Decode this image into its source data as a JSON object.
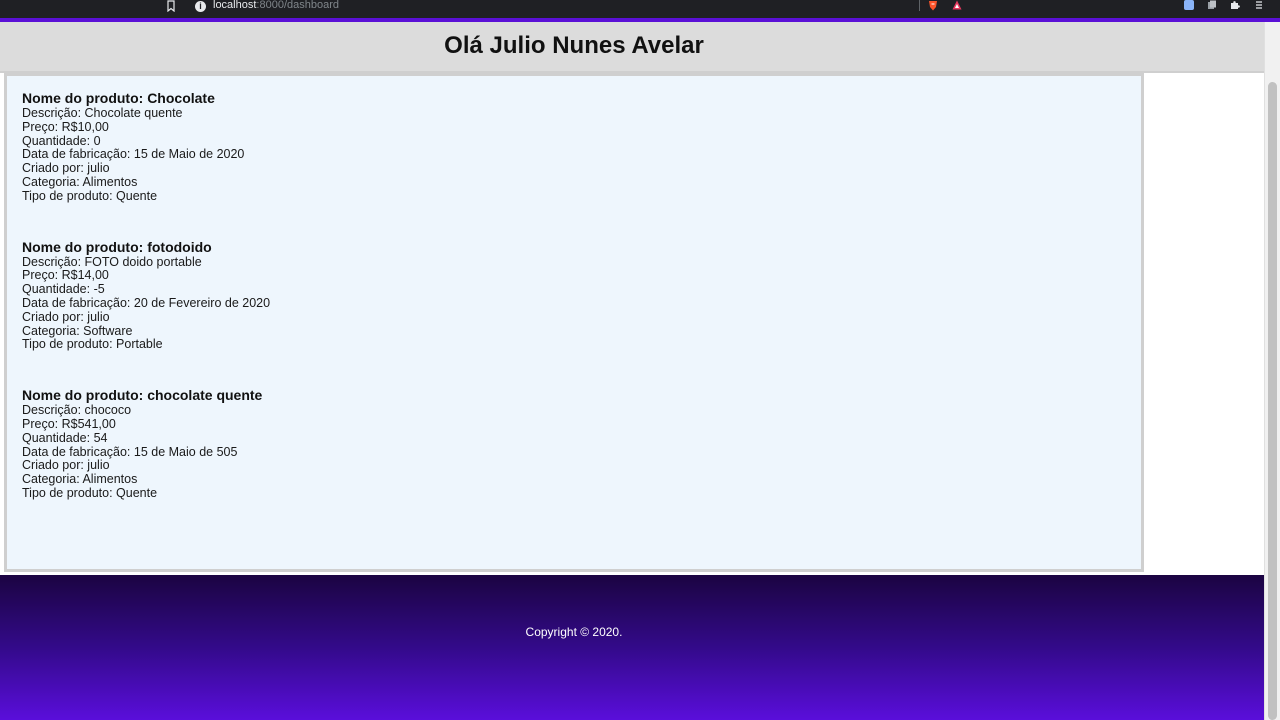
{
  "browser": {
    "url_host": "localhost",
    "url_path": ":8000/dashboard"
  },
  "header": {
    "title": "Olá Julio Nunes Avelar"
  },
  "products": [
    {
      "name": "Nome do produto: Chocolate",
      "description": "Descrição: Chocolate quente",
      "price": "Preço: R$10,00",
      "quantity": "Quantidade: 0",
      "date": "Data de fabricação: 15 de Maio de 2020",
      "created_by": "Criado por: julio",
      "category": "Categoria: Alimentos",
      "type": "Tipo de produto: Quente"
    },
    {
      "name": "Nome do produto: fotodoido",
      "description": "Descrição: FOTO doido portable",
      "price": "Preço: R$14,00",
      "quantity": "Quantidade: -5",
      "date": "Data de fabricação: 20 de Fevereiro de 2020",
      "created_by": "Criado por: julio",
      "category": "Categoria: Software",
      "type": "Tipo de produto: Portable"
    },
    {
      "name": "Nome do produto: chocolate quente",
      "description": "Descrição: chococo",
      "price": "Preço: R$541,00",
      "quantity": "Quantidade: 54",
      "date": "Data de fabricação: 15 de Maio de 505",
      "created_by": "Criado por: julio",
      "category": "Categoria: Alimentos",
      "type": "Tipo de produto: Quente"
    }
  ],
  "footer": {
    "copyright": "Copyright © 2020."
  },
  "colors": {
    "accent": "#5a10d6",
    "header_bg": "#dcdcdc",
    "content_bg": "#eef6fd",
    "footer_top": "#1b0441",
    "footer_bottom": "#5a0edb"
  },
  "icons": [
    "bookmark-icon",
    "info-icon",
    "brave-icon",
    "rewards-icon",
    "translate-icon",
    "docs-icon",
    "puzzle-icon",
    "menu-icon"
  ]
}
